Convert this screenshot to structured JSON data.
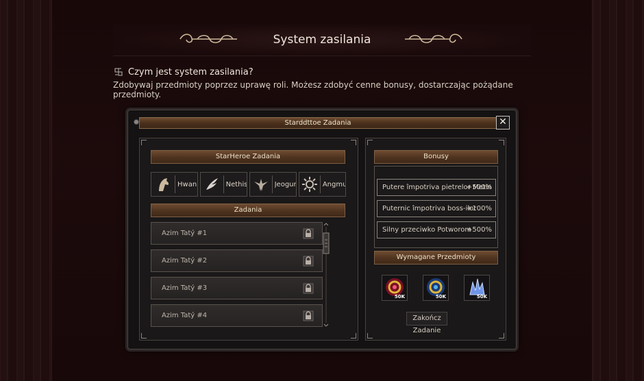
{
  "header": {
    "title": "System zasilania"
  },
  "intro": {
    "heading": "Czym jest system zasilania?",
    "text": "Zdobywaj przedmioty poprzez uprawę roli. Możesz zdobyć cenne bonusy, dostarczając pożądane przedmioty."
  },
  "window": {
    "title": "Starddttoe Zadania",
    "close_label": "✕"
  },
  "left_panel": {
    "heroes_title": "StarHeroe Zadania",
    "heroes": [
      {
        "name": "Hwan",
        "icon": "horse-head-icon"
      },
      {
        "name": "Nethis",
        "icon": "wing-icon"
      },
      {
        "name": "Jeogun",
        "icon": "eagle-emblem-icon"
      },
      {
        "name": "Angmur",
        "icon": "sun-emblem-icon"
      }
    ],
    "tasks_title": "Zadania",
    "tasks": [
      {
        "label": "Azim Tatý #1"
      },
      {
        "label": "Azim Tatý #2"
      },
      {
        "label": "Azim Tatý #3"
      },
      {
        "label": "Azim Tatý #4"
      }
    ]
  },
  "right_panel": {
    "bonus_title": "Bonusy",
    "bonuses": [
      {
        "name": "Putere împotriva pietrelor Metin",
        "value": "+500%"
      },
      {
        "name": "Puternic împotriva boss-ilor",
        "value": "+100%"
      },
      {
        "name": "Silny przeciwko Potworom",
        "value": "+500%"
      }
    ],
    "required_title": "Wymagane Przedmioty",
    "items": [
      {
        "qty": "50K",
        "icon": "red-ring-icon",
        "color": "#b3203a"
      },
      {
        "qty": "50K",
        "icon": "blue-ring-icon",
        "color": "#1f5aa8"
      },
      {
        "qty": "50K",
        "icon": "crystal-icon",
        "color": "#5a7fd6"
      }
    ],
    "finish_label": "Zakończ Zadanie"
  }
}
